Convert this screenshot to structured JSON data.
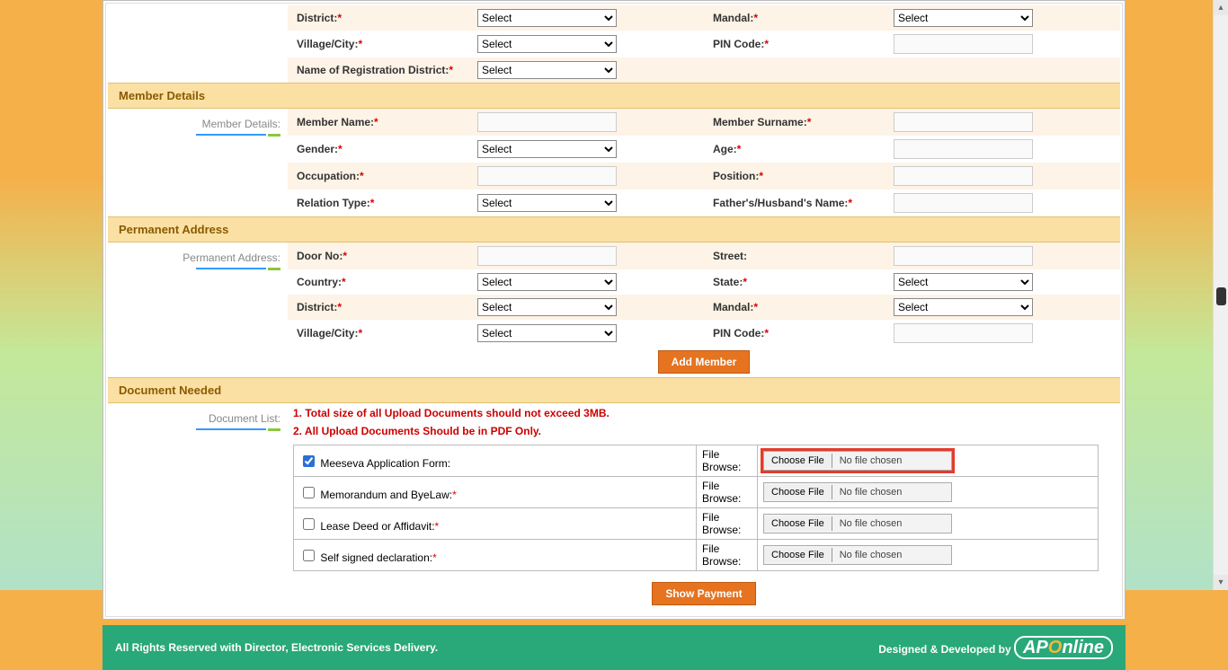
{
  "select_default": "Select",
  "top": {
    "district": "District:",
    "mandal": "Mandal:",
    "village": "Village/City:",
    "pin": "PIN Code:",
    "regdist": "Name of Registration District:"
  },
  "sections": {
    "member_details": "Member Details",
    "permanent_address": "Permanent Address",
    "document_needed": "Document Needed"
  },
  "side": {
    "member_details": "Member Details:",
    "permanent_address": "Permanent Address:",
    "document_list": "Document List:"
  },
  "member": {
    "name": "Member Name:",
    "surname": "Member Surname:",
    "gender": "Gender:",
    "age": "Age:",
    "occupation": "Occupation:",
    "position": "Position:",
    "relation": "Relation Type:",
    "father": "Father's/Husband's Name:"
  },
  "addr": {
    "door": "Door No:",
    "street": "Street:",
    "country": "Country:",
    "state": "State:",
    "district": "District:",
    "mandal": "Mandal:",
    "village": "Village/City:",
    "pin": "PIN Code:"
  },
  "buttons": {
    "add_member": "Add Member",
    "show_payment": "Show Payment"
  },
  "doc": {
    "note1": "1. Total size of all Upload Documents should not exceed 3MB.",
    "note2": "2. All Upload Documents Should be in PDF Only.",
    "file_browse": "File Browse:",
    "choose": "Choose File",
    "nofile": "No file chosen",
    "rows": [
      {
        "label": "Meeseva Application Form:",
        "req": false,
        "checked": true,
        "highlight": true
      },
      {
        "label": "Memorandum and ByeLaw:",
        "req": true,
        "checked": false,
        "highlight": false
      },
      {
        "label": "Lease Deed or Affidavit:",
        "req": true,
        "checked": false,
        "highlight": false
      },
      {
        "label": "Self signed declaration:",
        "req": true,
        "checked": false,
        "highlight": false
      }
    ]
  },
  "footer": {
    "left": "All Rights Reserved with Director, Electronic Services Delivery.",
    "right": "Designed & Developed by"
  }
}
